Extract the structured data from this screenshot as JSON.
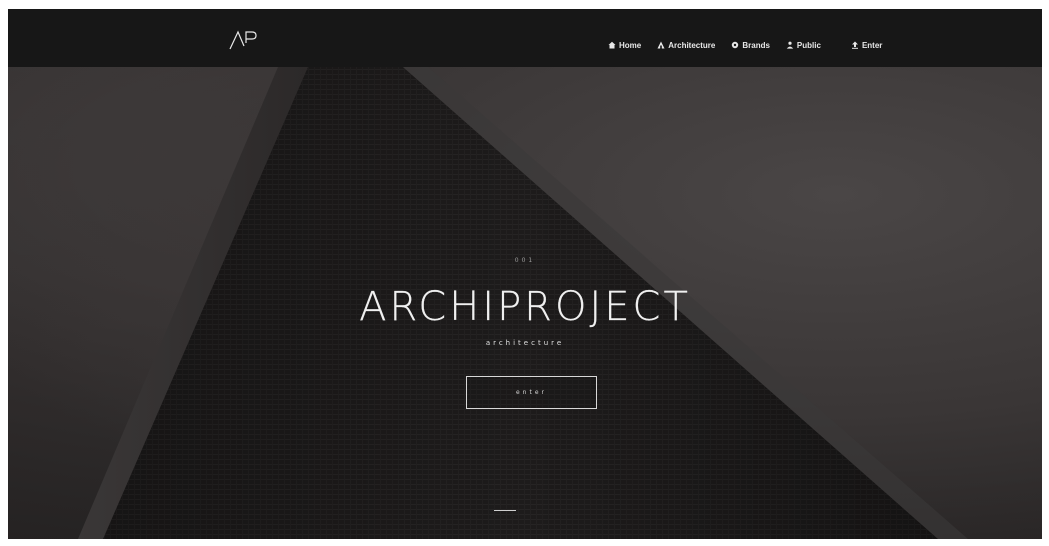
{
  "brand": {
    "logo_name": "ap-logo"
  },
  "nav": {
    "items": [
      {
        "label": "Home",
        "icon": "home-icon"
      },
      {
        "label": "Architecture",
        "icon": "sitemap-icon"
      },
      {
        "label": "Brands",
        "icon": "gear-icon"
      },
      {
        "label": "Public",
        "icon": "users-icon"
      },
      {
        "label": "Enter",
        "icon": "login-icon"
      }
    ]
  },
  "hero": {
    "eyebrow": "001",
    "title": "ARCHIPROJECT",
    "subtitle": "architecture",
    "button_label": "enter"
  },
  "colors": {
    "navbar_bg": "#161616",
    "hero_bg": "#2a2828",
    "text_primary": "#f0f0f0",
    "button_border": "#d8d8d8"
  }
}
